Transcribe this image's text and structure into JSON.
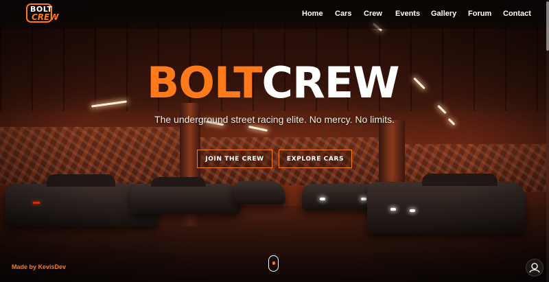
{
  "brand": {
    "logo_top": "BOLT",
    "logo_bottom": "CREW",
    "accent": "#ff7a1a"
  },
  "nav": {
    "items": [
      {
        "label": "Home"
      },
      {
        "label": "Cars"
      },
      {
        "label": "Crew"
      },
      {
        "label": "Events"
      },
      {
        "label": "Gallery"
      },
      {
        "label": "Forum"
      },
      {
        "label": "Contact"
      }
    ]
  },
  "hero": {
    "title_part1": "BOLT",
    "title_part2": "CREW",
    "tagline": "The underground street racing elite. No mercy. No limits.",
    "primary_cta": "JOIN THE CREW",
    "secondary_cta": "EXPLORE CARS"
  },
  "footer": {
    "credit": "Made by KevisDev"
  },
  "icons": {
    "scroll": "scroll-mouse-icon",
    "fab": "mechanic-avatar-icon"
  }
}
